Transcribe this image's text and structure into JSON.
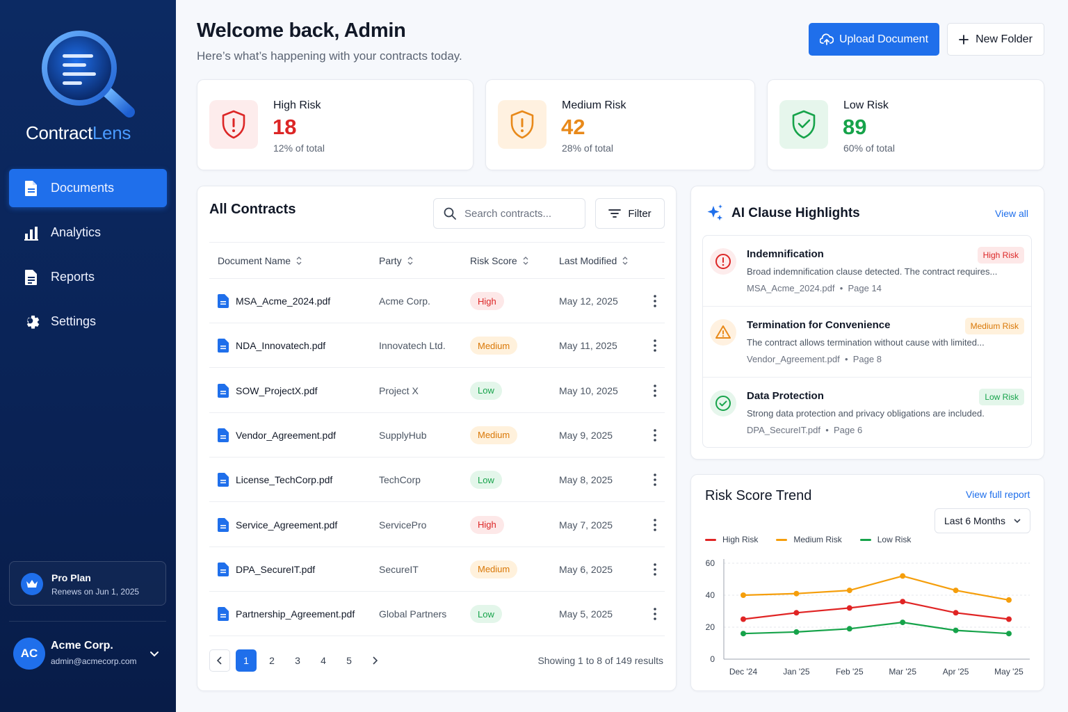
{
  "brand": {
    "name_part1": "Contract",
    "name_part2": "Lens"
  },
  "sidebar": {
    "items": [
      {
        "label": "Documents",
        "icon": "document-icon",
        "active": true
      },
      {
        "label": "Analytics",
        "icon": "bar-chart-icon",
        "active": false
      },
      {
        "label": "Reports",
        "icon": "report-icon",
        "active": false
      },
      {
        "label": "Settings",
        "icon": "gear-icon",
        "active": false
      }
    ],
    "plan": {
      "title": "Pro Plan",
      "subtitle": "Renews on Jun 1, 2025"
    },
    "user": {
      "initials": "AC",
      "name": "Acme Corp.",
      "email": "admin@acmecorp.com"
    }
  },
  "header": {
    "title": "Welcome back, Admin",
    "subtitle": "Here’s what’s happening with your contracts today.",
    "upload_label": "Upload Document",
    "new_folder_label": "New Folder"
  },
  "stats": [
    {
      "label": "High Risk",
      "value": "18",
      "pct": "12% of total",
      "color": "#dc2626",
      "bg": "#fdecec"
    },
    {
      "label": "Medium Risk",
      "value": "42",
      "pct": "28% of total",
      "color": "#e8891a",
      "bg": "#fff1e0"
    },
    {
      "label": "Low Risk",
      "value": "89",
      "pct": "60% of total",
      "color": "#16a34a",
      "bg": "#e6f6ec"
    }
  ],
  "contracts": {
    "title": "All Contracts",
    "search_placeholder": "Search contracts...",
    "filter_label": "Filter",
    "columns": [
      "Document Name",
      "Party",
      "Risk Score",
      "Last Modified"
    ],
    "rows": [
      {
        "name": "MSA_Acme_2024.pdf",
        "party": "Acme Corp.",
        "risk": "High",
        "date": "May 12, 2025"
      },
      {
        "name": "NDA_Innovatech.pdf",
        "party": "Innovatech Ltd.",
        "risk": "Medium",
        "date": "May 11, 2025"
      },
      {
        "name": "SOW_ProjectX.pdf",
        "party": "Project X",
        "risk": "Low",
        "date": "May 10, 2025"
      },
      {
        "name": "Vendor_Agreement.pdf",
        "party": "SupplyHub",
        "risk": "Medium",
        "date": "May 9, 2025"
      },
      {
        "name": "License_TechCorp.pdf",
        "party": "TechCorp",
        "risk": "Low",
        "date": "May 8, 2025"
      },
      {
        "name": "Service_Agreement.pdf",
        "party": "ServicePro",
        "risk": "High",
        "date": "May 7, 2025"
      },
      {
        "name": "DPA_SecureIT.pdf",
        "party": "SecureIT",
        "risk": "Medium",
        "date": "May 6, 2025"
      },
      {
        "name": "Partnership_Agreement.pdf",
        "party": "Global Partners",
        "risk": "Low",
        "date": "May 5, 2025"
      }
    ],
    "pages": [
      "1",
      "2",
      "3",
      "4",
      "5"
    ],
    "current_page": "1",
    "showing": "Showing 1 to 8 of 149 results"
  },
  "ai": {
    "title": "AI Clause Highlights",
    "view_all": "View all",
    "items": [
      {
        "title": "Indemnification",
        "badge": "High Risk",
        "level": "high",
        "desc": "Broad indemnification clause detected. The contract requires...",
        "file": "MSA_Acme_2024.pdf",
        "page": "Page 14"
      },
      {
        "title": "Termination for Convenience",
        "badge": "Medium Risk",
        "level": "medium",
        "desc": "The contract allows termination without cause with limited...",
        "file": "Vendor_Agreement.pdf",
        "page": "Page 8"
      },
      {
        "title": "Data Protection",
        "badge": "Low Risk",
        "level": "low",
        "desc": "Strong data protection and privacy obligations are included.",
        "file": "DPA_SecureIT.pdf",
        "page": "Page 6"
      }
    ]
  },
  "trend": {
    "title": "Risk Score Trend",
    "view_full": "View full report",
    "range": "Last 6 Months"
  },
  "chart_data": {
    "type": "line",
    "title": "Risk Score Trend",
    "categories": [
      "Dec '24",
      "Jan '25",
      "Feb '25",
      "Mar '25",
      "Apr '25",
      "May '25"
    ],
    "ylim": [
      0,
      60
    ],
    "yticks": [
      0,
      20,
      40,
      60
    ],
    "grid": true,
    "legend": "top-left",
    "series": [
      {
        "name": "High Risk",
        "color": "#e02424",
        "values": [
          25,
          29,
          32,
          36,
          29,
          25
        ]
      },
      {
        "name": "Medium Risk",
        "color": "#f59e0b",
        "values": [
          40,
          41,
          43,
          52,
          43,
          37
        ]
      },
      {
        "name": "Low Risk",
        "color": "#16a34a",
        "values": [
          16,
          17,
          19,
          23,
          18,
          16
        ]
      }
    ]
  }
}
